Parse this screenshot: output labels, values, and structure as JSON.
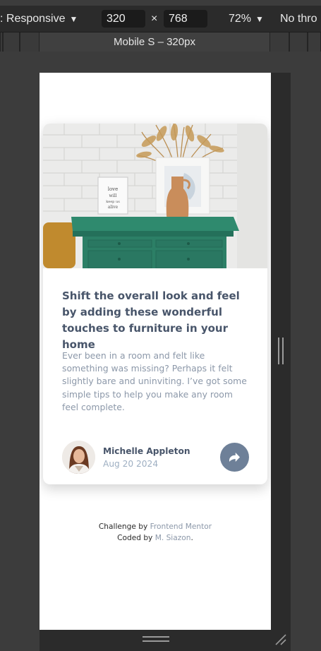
{
  "toolbar": {
    "dimensions_label": ": Responsive",
    "width_value": "320",
    "height_value": "768",
    "times_sign": "×",
    "zoom": "72%",
    "throttling": "No thro"
  },
  "device_bar": {
    "preset_label": "Mobile S – 320px"
  },
  "card": {
    "title": "Shift the overall look and feel by adding these wonderful touches to furniture in your home",
    "description": "Ever been in a room and felt like something was missing? Perhaps it felt slightly bare and uninviting. I’ve got some simple tips to help you make any room feel complete.",
    "author_name": "Michelle Appleton",
    "date": "Aug 20 2024",
    "image_sign_text": "love will keep us alive",
    "share_icon": "share-icon",
    "colors": {
      "title": "#48556a",
      "text": "#8c98a9",
      "share_button": "#6e8098",
      "cabinet": "#2e7d66"
    }
  },
  "attribution": {
    "line1_prefix": "Challenge by",
    "line1_link": "Frontend Mentor",
    "line2_prefix": "Coded by",
    "line2_link": "M. Siazon",
    "line2_suffix": "."
  }
}
